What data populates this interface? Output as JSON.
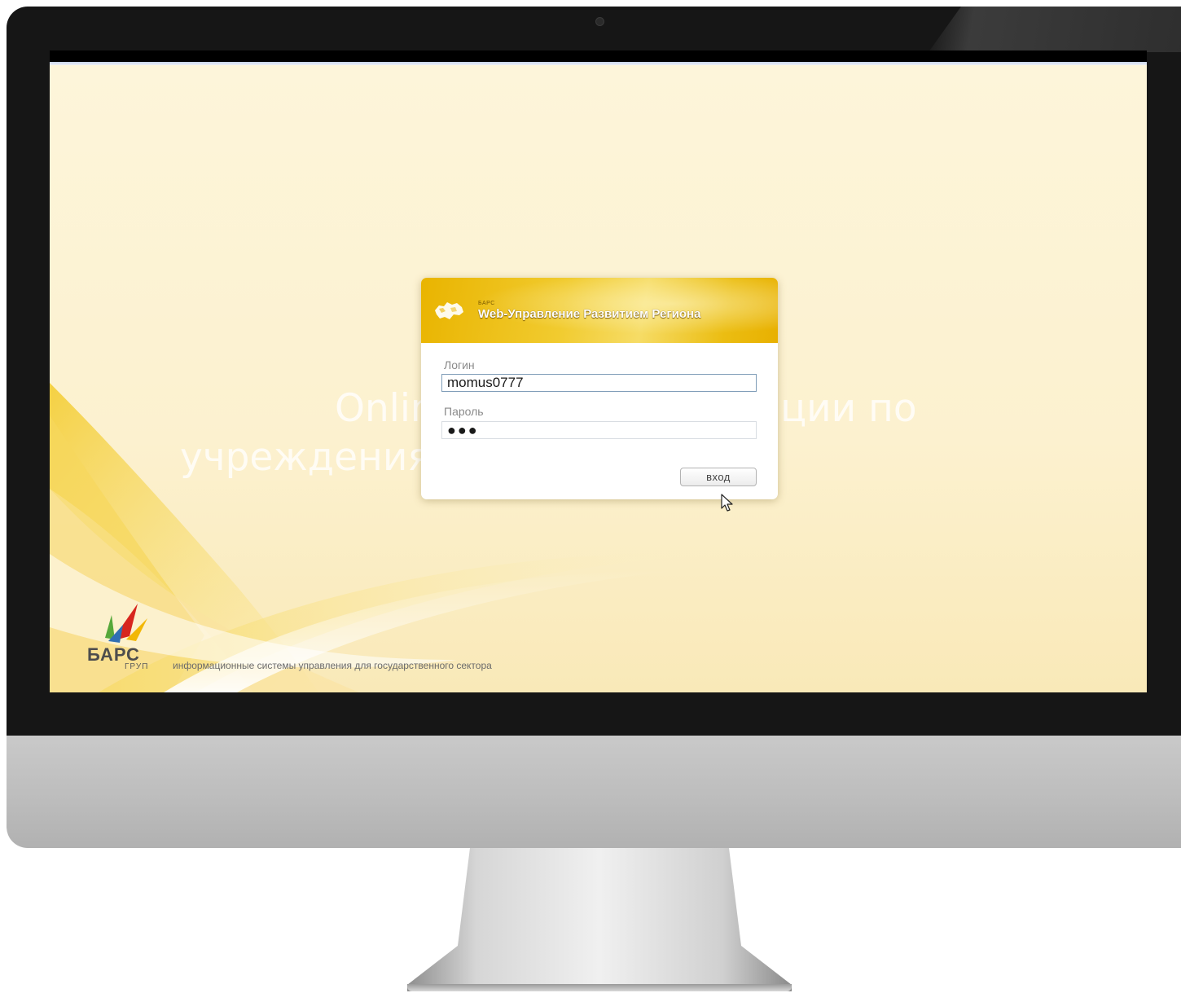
{
  "login_dialog": {
    "header_small": "БАРС",
    "header_title": "Web-Управление Развитием Региона",
    "login_label": "Логин",
    "login_value": "momus0777",
    "password_label": "Пароль",
    "password_value": "●●●",
    "submit_label": "вход"
  },
  "overlay_text": {
    "line1": "Online обзор информации по",
    "line2": "учреждениям"
  },
  "branding": {
    "company_name": "БАРС",
    "company_sub": "ГРУП",
    "tagline": "информационные системы управления для государственного сектора"
  },
  "colors": {
    "background": "#fdf4d8",
    "header_gold": "#e9b400",
    "swoosh_yellow": "#f5d54e"
  },
  "icons": {
    "header_logo": "region-map-icon",
    "cursor": "mouse-pointer-icon",
    "brand_logo": "bars-logo-icon"
  }
}
